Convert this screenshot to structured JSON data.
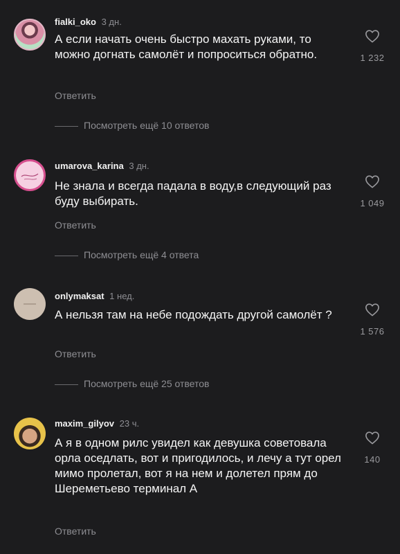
{
  "comments": [
    {
      "username": "fialki_oko",
      "time": "3 дн.",
      "text": "А если начать очень быстро махать руками, то можно догнать самолёт и попроситься обратно.",
      "likes": "1 232",
      "reply_label": "Ответить",
      "view_replies": "Посмотреть ещё 10 ответов",
      "avatar_icon": "user-photo-avatar"
    },
    {
      "username": "umarova_karina",
      "time": "3 дн.",
      "text": "Не знала и всегда падала в воду,в следующий раз буду выбирать.",
      "likes": "1 049",
      "reply_label": "Ответить",
      "view_replies": "Посмотреть ещё 4 ответа",
      "avatar_icon": "signature-logo-avatar"
    },
    {
      "username": "onlymaksat",
      "time": "1 нед.",
      "text": "А нельзя там на небе подождать другой самолёт ?",
      "likes": "1 576",
      "reply_label": "Ответить",
      "view_replies": "Посмотреть ещё 25 ответов",
      "avatar_icon": "beige-logo-avatar"
    },
    {
      "username": "maxim_gilyov",
      "time": "23 ч.",
      "text": "А я в одном рилс  увидел как девушка советовала орла оседлать, вот и пригодилось, и лечу а тут орел мимо пролетал, вот я на нем и долетел прям до Шереметьево терминал А",
      "likes": "140",
      "reply_label": "Ответить",
      "avatar_icon": "user-photo-avatar"
    }
  ],
  "colors": {
    "background": "#1c1c1e",
    "text": "#f5f5f5",
    "secondary": "#8e8e93"
  },
  "icons": {
    "like": "heart-outline-icon"
  }
}
